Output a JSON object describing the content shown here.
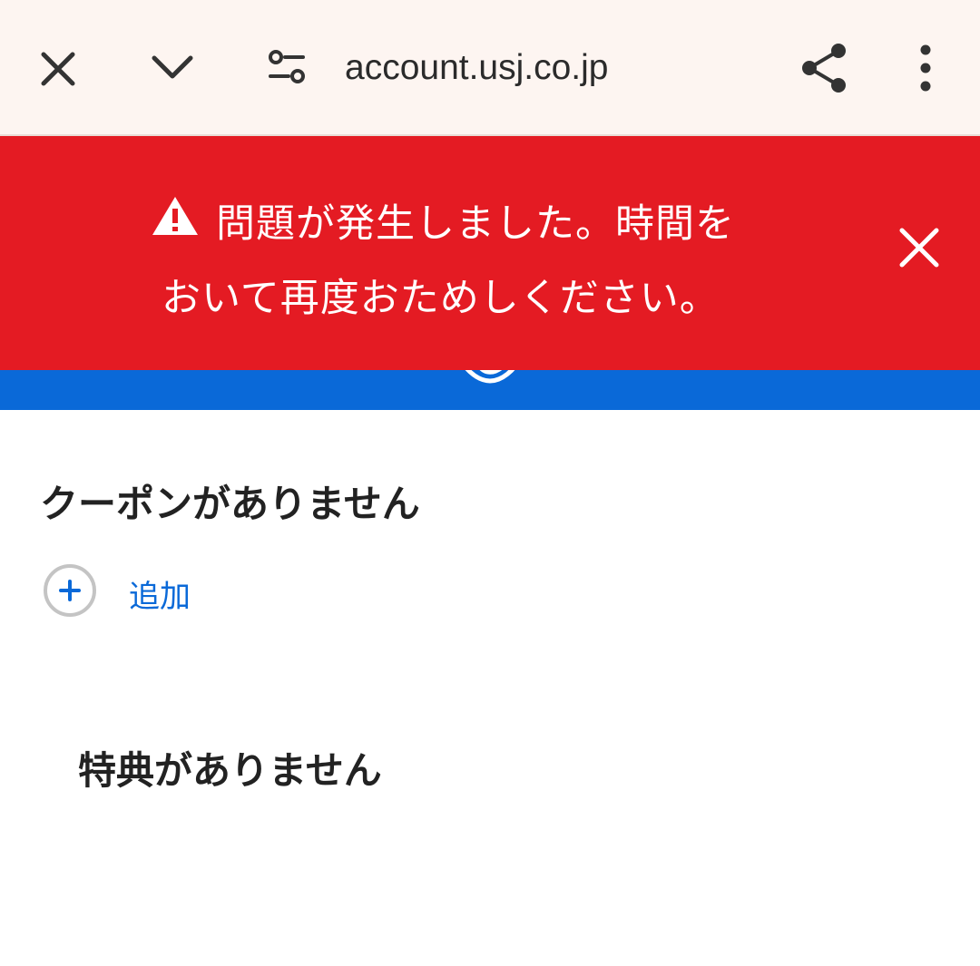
{
  "browser": {
    "url": "account.usj.co.jp",
    "icons": {
      "close": "close-icon",
      "collapse": "chevron-down-icon",
      "site_settings": "tune-icon",
      "share": "share-icon",
      "menu": "more-vert-icon"
    },
    "background_color": "#fdf5f1"
  },
  "error_banner": {
    "line1": "問題が発生しました。時間を",
    "line2": "おいて再度おためしください。",
    "icon": "warning-icon",
    "close_icon": "close-icon",
    "color": "#e41b23"
  },
  "header": {
    "color": "#0a69d8"
  },
  "coupons": {
    "title": "クーポンがありません",
    "add_label": "追加"
  },
  "benefits": {
    "title": "特典がありません"
  }
}
